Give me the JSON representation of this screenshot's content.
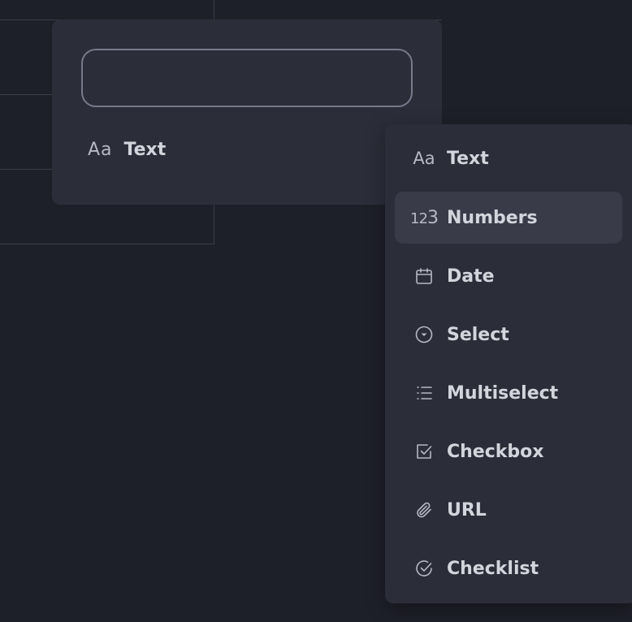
{
  "editor": {
    "name_value": "",
    "current_type": {
      "icon": "text-icon",
      "label": "Text"
    }
  },
  "type_menu": {
    "items": [
      {
        "icon": "text-icon",
        "label": "Text",
        "active": false
      },
      {
        "icon": "numbers-icon",
        "label": "Numbers",
        "active": true
      },
      {
        "icon": "calendar-icon",
        "label": "Date",
        "active": false
      },
      {
        "icon": "select-icon",
        "label": "Select",
        "active": false
      },
      {
        "icon": "list-icon",
        "label": "Multiselect",
        "active": false
      },
      {
        "icon": "checkbox-icon",
        "label": "Checkbox",
        "active": false
      },
      {
        "icon": "paperclip-icon",
        "label": "URL",
        "active": false
      },
      {
        "icon": "check-circle-icon",
        "label": "Checklist",
        "active": false
      }
    ]
  },
  "colors": {
    "background": "#1e2029",
    "panel": "#2b2e39",
    "hover": "#393c48",
    "text": "#d3d5dc",
    "icon": "#b6b9c4"
  }
}
